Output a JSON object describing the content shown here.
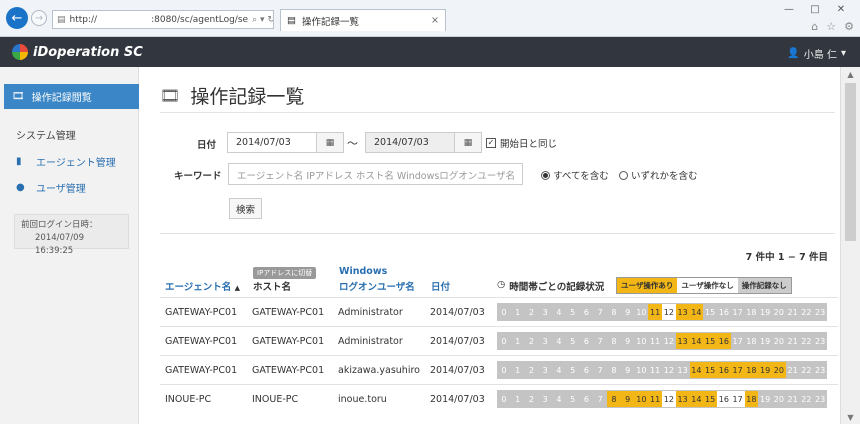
{
  "browser": {
    "url": "http://      :8080/sc/agentLog/se",
    "url_actions": "⌕ ▾ ↻",
    "tab_title": "操作記録一覧",
    "tab_close": "×",
    "win_min": "—",
    "win_max": "□",
    "win_close": "✕"
  },
  "app": {
    "logo": "iDoperation SC",
    "user": "小島 仁"
  },
  "sidebar": {
    "active_item": "操作記録閲覧",
    "group_label": "システム管理",
    "items": [
      {
        "label": "エージェント管理",
        "icon": "video-camera-icon"
      },
      {
        "label": "ユーザ管理",
        "icon": "user-icon"
      }
    ],
    "last_login_label": "前回ログイン日時：",
    "last_login_value": "2014/07/09 16:39:25"
  },
  "page": {
    "title": "操作記録一覧"
  },
  "search": {
    "date_label": "日付",
    "date_from": "2014/07/03",
    "date_to": "2014/07/03",
    "tilde": "〜",
    "same_as_start_label": "開始日と同じ",
    "same_as_start_checked": true,
    "keyword_label": "キーワード",
    "keyword_placeholder": "エージェント名 IPアドレス ホスト名 Windowsログオンユーザ名",
    "radio_all": "すべてを含む",
    "radio_any": "いずれかを含む",
    "search_button": "検索"
  },
  "results": {
    "count_text": "7 件中 1 − 7 件目",
    "columns": {
      "agent": "エージェント名",
      "sort_arrow": "▲",
      "ip_toggle": "IPアドレスに切替",
      "host": "ホスト名",
      "win_user_1": "Windows",
      "win_user_2": "ログオンユーザ名",
      "date": "日付",
      "hourly": "時間帯ごとの記録状況"
    },
    "legend": {
      "user_op": "ユーザ操作あり",
      "no_user_op": "ユーザ操作なし",
      "no_record": "操作記録なし"
    },
    "rows": [
      {
        "agent": "GATEWAY-PC01",
        "host": "GATEWAY-PC01",
        "user": "Administrator",
        "date": "2014/07/03",
        "op": [
          11,
          13,
          14
        ],
        "noop": [
          12
        ]
      },
      {
        "agent": "GATEWAY-PC01",
        "host": "GATEWAY-PC01",
        "user": "Administrator",
        "date": "2014/07/03",
        "op": [
          13,
          14,
          15,
          16
        ],
        "noop": []
      },
      {
        "agent": "GATEWAY-PC01",
        "host": "GATEWAY-PC01",
        "user": "akizawa.yasuhiro",
        "date": "2014/07/03",
        "op": [
          14,
          15,
          16,
          17,
          18,
          19,
          20
        ],
        "noop": []
      },
      {
        "agent": "INOUE-PC",
        "host": "INOUE-PC",
        "user": "inoue.toru",
        "date": "2014/07/03",
        "op": [
          8,
          9,
          10,
          11,
          13,
          14,
          15,
          18
        ],
        "noop": [
          12,
          16,
          17
        ]
      }
    ],
    "hours": [
      "0",
      "1",
      "2",
      "3",
      "4",
      "5",
      "6",
      "7",
      "8",
      "9",
      "10",
      "11",
      "12",
      "13",
      "14",
      "15",
      "16",
      "17",
      "18",
      "19",
      "20",
      "21",
      "22",
      "23"
    ]
  },
  "colors": {
    "topbar": "#32373f",
    "accent": "#3b86c6",
    "user_op": "#f2b616",
    "no_record": "#c4c4c4"
  }
}
